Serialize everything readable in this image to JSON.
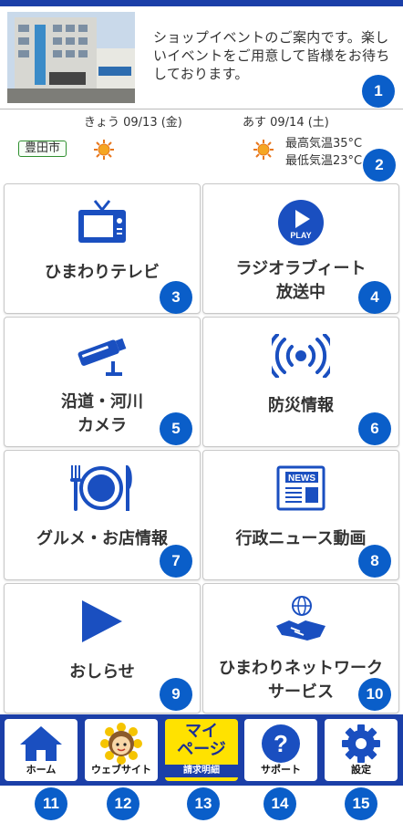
{
  "banner": {
    "photo_alt": "ひまわりネットワーク 社屋",
    "text": "ショップイベントのご案内です。楽しいイベントをご用意して皆様をお待ちしております。"
  },
  "weather": {
    "today_label": "きょう 09/13 (金)",
    "tomorrow_label": "あす 09/14 (土)",
    "city": "豊田市",
    "today_icon": "sun-icon",
    "tomorrow_icon": "sun-icon",
    "high": "最高気温35°C",
    "low": "最低気温23°C"
  },
  "tiles": [
    {
      "label": "ひまわりテレビ",
      "icon": "tv-icon",
      "number": "3"
    },
    {
      "label": "ラジオラブィート放送中",
      "label_line1": "ラジオラブィート",
      "label_line2": "放送中",
      "icon": "play-icon",
      "play_text": "PLAY",
      "number": "4"
    },
    {
      "label_line1": "沿道・河川",
      "label_line2": "カメラ",
      "icon": "camera-icon",
      "number": "5"
    },
    {
      "label": "防災情報",
      "icon": "broadcast-icon",
      "number": "6"
    },
    {
      "label": "グルメ・お店情報",
      "icon": "dining-icon",
      "number": "7"
    },
    {
      "label": "行政ニュース動画",
      "icon": "news-icon",
      "news_text": "NEWS",
      "number": "8"
    },
    {
      "label": "おしらせ",
      "icon": "triangle-play-icon",
      "number": "9"
    },
    {
      "label_line1": "ひまわりネットワーク",
      "label_line2": "サービス",
      "icon": "handshake-icon",
      "number": "10"
    }
  ],
  "badges": {
    "banner": "1",
    "weather": "2"
  },
  "nav": [
    {
      "label": "ホーム",
      "icon": "home-icon",
      "number": "11"
    },
    {
      "label": "ウェブサイト",
      "icon": "sunflower-mascot-icon",
      "number": "12"
    },
    {
      "title_line1": "マイ",
      "title_line2": "ページ",
      "sub": "請求明細",
      "number": "13"
    },
    {
      "label": "サポート",
      "icon": "help-icon",
      "number": "14"
    },
    {
      "label": "設定",
      "icon": "gear-icon",
      "number": "15"
    }
  ],
  "colors": {
    "brand_blue": "#1b3fa8",
    "accent_blue": "#0a5ec9",
    "mypage_yellow": "#ffe200"
  }
}
